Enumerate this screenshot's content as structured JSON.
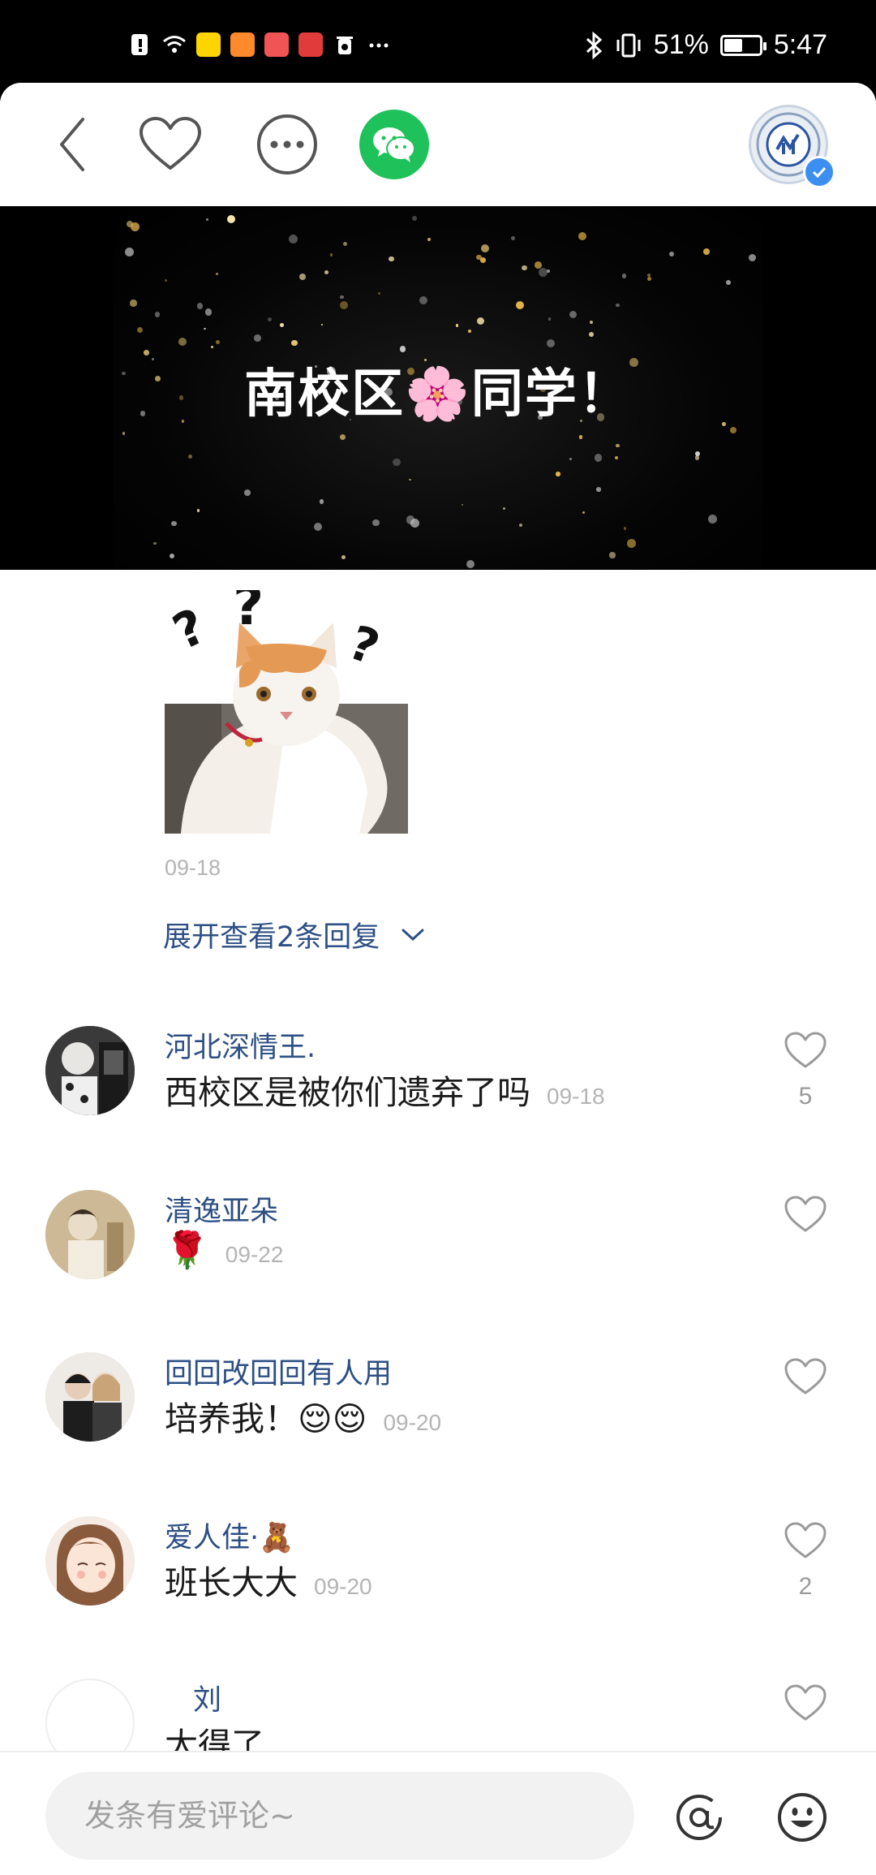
{
  "status_bar": {
    "battery": "51%",
    "time": "5:47",
    "battery_level": 0.51
  },
  "video": {
    "title": "南校区🌸同学！"
  },
  "reply": {
    "date": "09-18",
    "expand_label": "展开查看2条回复"
  },
  "comments": [
    {
      "name": "河北深情王.",
      "text": "西校区是被你们遗弃了吗",
      "date": "09-18",
      "likes": "5"
    },
    {
      "name": "清逸亚朵",
      "text": "🌹",
      "date": "09-22",
      "likes": ""
    },
    {
      "name": "回回改回回有人用",
      "text": "培养我！😌😌",
      "date": "09-20",
      "likes": ""
    },
    {
      "name": "爱人佳·🧸",
      "text": "班长大大",
      "date": "09-20",
      "likes": "2"
    },
    {
      "name": "刘",
      "text": "太得了",
      "date": "",
      "likes": ""
    }
  ],
  "input": {
    "placeholder": "发条有爱评论~"
  },
  "colors": {
    "accent_link": "#2d4f84",
    "wechat_green": "#1fc15a",
    "verified_blue": "#3b8ff0"
  }
}
